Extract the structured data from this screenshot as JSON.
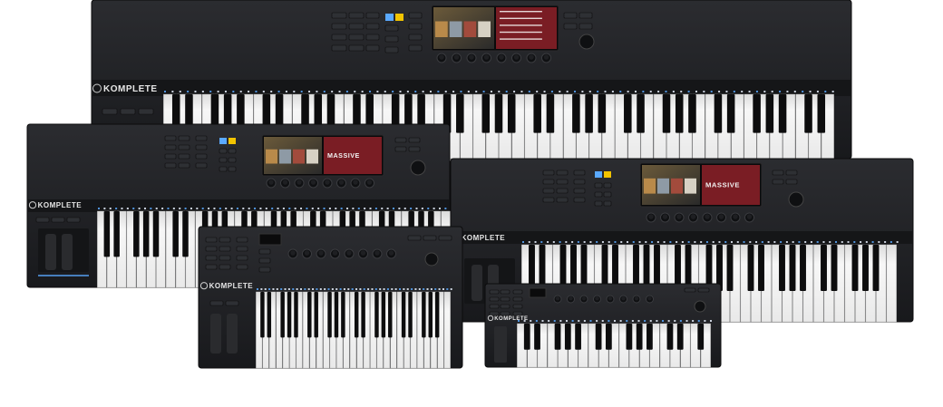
{
  "brand": {
    "logo_text": "KOMPLETE",
    "screen_preset": "MASSIVE"
  },
  "colors": {
    "background": "#ffffff",
    "body": "#1c1d20",
    "body_top": "#2a2b2f",
    "panel": "#151618",
    "white_key": "#f4f4f4",
    "black_key": "#0d0d0e",
    "screen_red": "#7a1d24",
    "led_blue": "#5aa9ff",
    "led_yellow": "#f2c400",
    "knob": "#0f1012"
  },
  "keyboards": [
    {
      "model_note": "88-key",
      "white_keys": 52
    },
    {
      "model_note": "61-key",
      "white_keys": 36
    },
    {
      "model_note": "61-key",
      "white_keys": 36
    },
    {
      "model_note": "49-key",
      "white_keys": 29
    },
    {
      "model_note": "32-key",
      "white_keys": 19
    }
  ]
}
